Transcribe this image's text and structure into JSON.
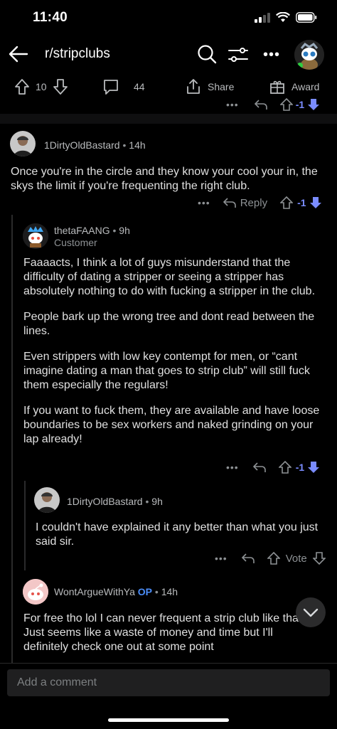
{
  "status": {
    "time": "11:40"
  },
  "nav": {
    "subreddit": "r/stripclubs"
  },
  "post_actions": {
    "score": "10",
    "comments": "44",
    "share": "Share",
    "award": "Award"
  },
  "top_row": {
    "score": "-1"
  },
  "comments": [
    {
      "author": "1DirtyOldBastard",
      "age": "14h",
      "body": [
        "Once you're in the circle and they know your cool your in, the skys the limit if you're frequenting the right club."
      ],
      "reply_label": "Reply",
      "score": "-1"
    },
    {
      "author": "thetaFAANG",
      "age": "9h",
      "flair": "Customer",
      "body": [
        "Faaaacts, I think a lot of guys misunderstand that the difficulty of dating a stripper or seeing a stripper has absolutely nothing to do with fucking a stripper in the club.",
        "People bark up the wrong tree and dont read between the lines.",
        "Even strippers with low key contempt for men, or “cant imagine dating a man that goes to strip club” will still fuck them especially the regulars!",
        "If you want to fuck them, they are available and have loose boundaries to be sex workers and naked grinding on your lap already!"
      ],
      "score": "-1"
    },
    {
      "author": "1DirtyOldBastard",
      "age": "9h",
      "body": [
        "I couldn't have explained it any better than what you just said sir."
      ],
      "vote_label": "Vote"
    },
    {
      "author": "WontArgueWithYa",
      "op_tag": "OP",
      "age": "14h",
      "body": [
        "For free tho lol I can never frequent a strip club like that. Just seems like a waste of money and time but I'll definitely check one out at some point"
      ]
    }
  ],
  "composer": {
    "placeholder": "Add a comment"
  },
  "colors": {
    "downvote_active": "#7a8cff",
    "op": "#4b8df8",
    "background": "#000000"
  }
}
